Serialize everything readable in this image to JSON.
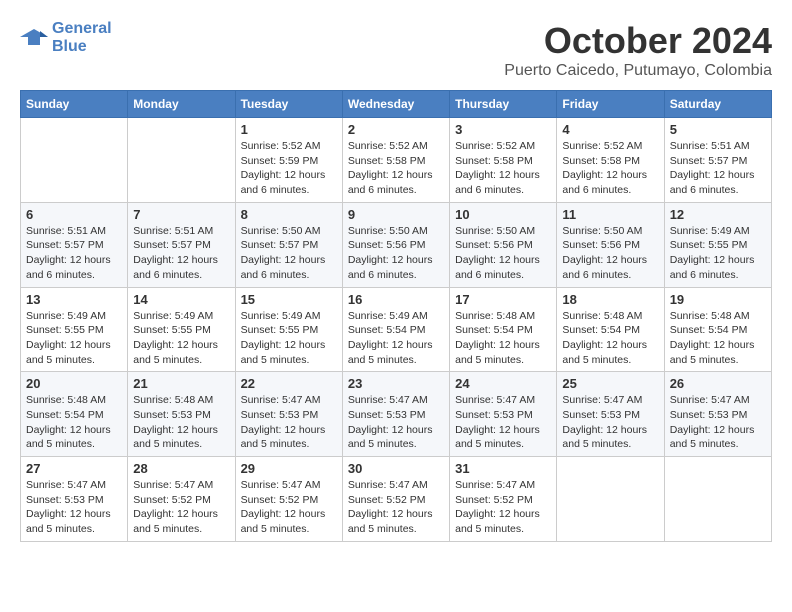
{
  "header": {
    "logo_line1": "General",
    "logo_line2": "Blue",
    "month": "October 2024",
    "location": "Puerto Caicedo, Putumayo, Colombia"
  },
  "days_of_week": [
    "Sunday",
    "Monday",
    "Tuesday",
    "Wednesday",
    "Thursday",
    "Friday",
    "Saturday"
  ],
  "weeks": [
    [
      {
        "day": "",
        "info": ""
      },
      {
        "day": "",
        "info": ""
      },
      {
        "day": "1",
        "info": "Sunrise: 5:52 AM\nSunset: 5:59 PM\nDaylight: 12 hours and 6 minutes."
      },
      {
        "day": "2",
        "info": "Sunrise: 5:52 AM\nSunset: 5:58 PM\nDaylight: 12 hours and 6 minutes."
      },
      {
        "day": "3",
        "info": "Sunrise: 5:52 AM\nSunset: 5:58 PM\nDaylight: 12 hours and 6 minutes."
      },
      {
        "day": "4",
        "info": "Sunrise: 5:52 AM\nSunset: 5:58 PM\nDaylight: 12 hours and 6 minutes."
      },
      {
        "day": "5",
        "info": "Sunrise: 5:51 AM\nSunset: 5:57 PM\nDaylight: 12 hours and 6 minutes."
      }
    ],
    [
      {
        "day": "6",
        "info": "Sunrise: 5:51 AM\nSunset: 5:57 PM\nDaylight: 12 hours and 6 minutes."
      },
      {
        "day": "7",
        "info": "Sunrise: 5:51 AM\nSunset: 5:57 PM\nDaylight: 12 hours and 6 minutes."
      },
      {
        "day": "8",
        "info": "Sunrise: 5:50 AM\nSunset: 5:57 PM\nDaylight: 12 hours and 6 minutes."
      },
      {
        "day": "9",
        "info": "Sunrise: 5:50 AM\nSunset: 5:56 PM\nDaylight: 12 hours and 6 minutes."
      },
      {
        "day": "10",
        "info": "Sunrise: 5:50 AM\nSunset: 5:56 PM\nDaylight: 12 hours and 6 minutes."
      },
      {
        "day": "11",
        "info": "Sunrise: 5:50 AM\nSunset: 5:56 PM\nDaylight: 12 hours and 6 minutes."
      },
      {
        "day": "12",
        "info": "Sunrise: 5:49 AM\nSunset: 5:55 PM\nDaylight: 12 hours and 6 minutes."
      }
    ],
    [
      {
        "day": "13",
        "info": "Sunrise: 5:49 AM\nSunset: 5:55 PM\nDaylight: 12 hours and 5 minutes."
      },
      {
        "day": "14",
        "info": "Sunrise: 5:49 AM\nSunset: 5:55 PM\nDaylight: 12 hours and 5 minutes."
      },
      {
        "day": "15",
        "info": "Sunrise: 5:49 AM\nSunset: 5:55 PM\nDaylight: 12 hours and 5 minutes."
      },
      {
        "day": "16",
        "info": "Sunrise: 5:49 AM\nSunset: 5:54 PM\nDaylight: 12 hours and 5 minutes."
      },
      {
        "day": "17",
        "info": "Sunrise: 5:48 AM\nSunset: 5:54 PM\nDaylight: 12 hours and 5 minutes."
      },
      {
        "day": "18",
        "info": "Sunrise: 5:48 AM\nSunset: 5:54 PM\nDaylight: 12 hours and 5 minutes."
      },
      {
        "day": "19",
        "info": "Sunrise: 5:48 AM\nSunset: 5:54 PM\nDaylight: 12 hours and 5 minutes."
      }
    ],
    [
      {
        "day": "20",
        "info": "Sunrise: 5:48 AM\nSunset: 5:54 PM\nDaylight: 12 hours and 5 minutes."
      },
      {
        "day": "21",
        "info": "Sunrise: 5:48 AM\nSunset: 5:53 PM\nDaylight: 12 hours and 5 minutes."
      },
      {
        "day": "22",
        "info": "Sunrise: 5:47 AM\nSunset: 5:53 PM\nDaylight: 12 hours and 5 minutes."
      },
      {
        "day": "23",
        "info": "Sunrise: 5:47 AM\nSunset: 5:53 PM\nDaylight: 12 hours and 5 minutes."
      },
      {
        "day": "24",
        "info": "Sunrise: 5:47 AM\nSunset: 5:53 PM\nDaylight: 12 hours and 5 minutes."
      },
      {
        "day": "25",
        "info": "Sunrise: 5:47 AM\nSunset: 5:53 PM\nDaylight: 12 hours and 5 minutes."
      },
      {
        "day": "26",
        "info": "Sunrise: 5:47 AM\nSunset: 5:53 PM\nDaylight: 12 hours and 5 minutes."
      }
    ],
    [
      {
        "day": "27",
        "info": "Sunrise: 5:47 AM\nSunset: 5:53 PM\nDaylight: 12 hours and 5 minutes."
      },
      {
        "day": "28",
        "info": "Sunrise: 5:47 AM\nSunset: 5:52 PM\nDaylight: 12 hours and 5 minutes."
      },
      {
        "day": "29",
        "info": "Sunrise: 5:47 AM\nSunset: 5:52 PM\nDaylight: 12 hours and 5 minutes."
      },
      {
        "day": "30",
        "info": "Sunrise: 5:47 AM\nSunset: 5:52 PM\nDaylight: 12 hours and 5 minutes."
      },
      {
        "day": "31",
        "info": "Sunrise: 5:47 AM\nSunset: 5:52 PM\nDaylight: 12 hours and 5 minutes."
      },
      {
        "day": "",
        "info": ""
      },
      {
        "day": "",
        "info": ""
      }
    ]
  ]
}
